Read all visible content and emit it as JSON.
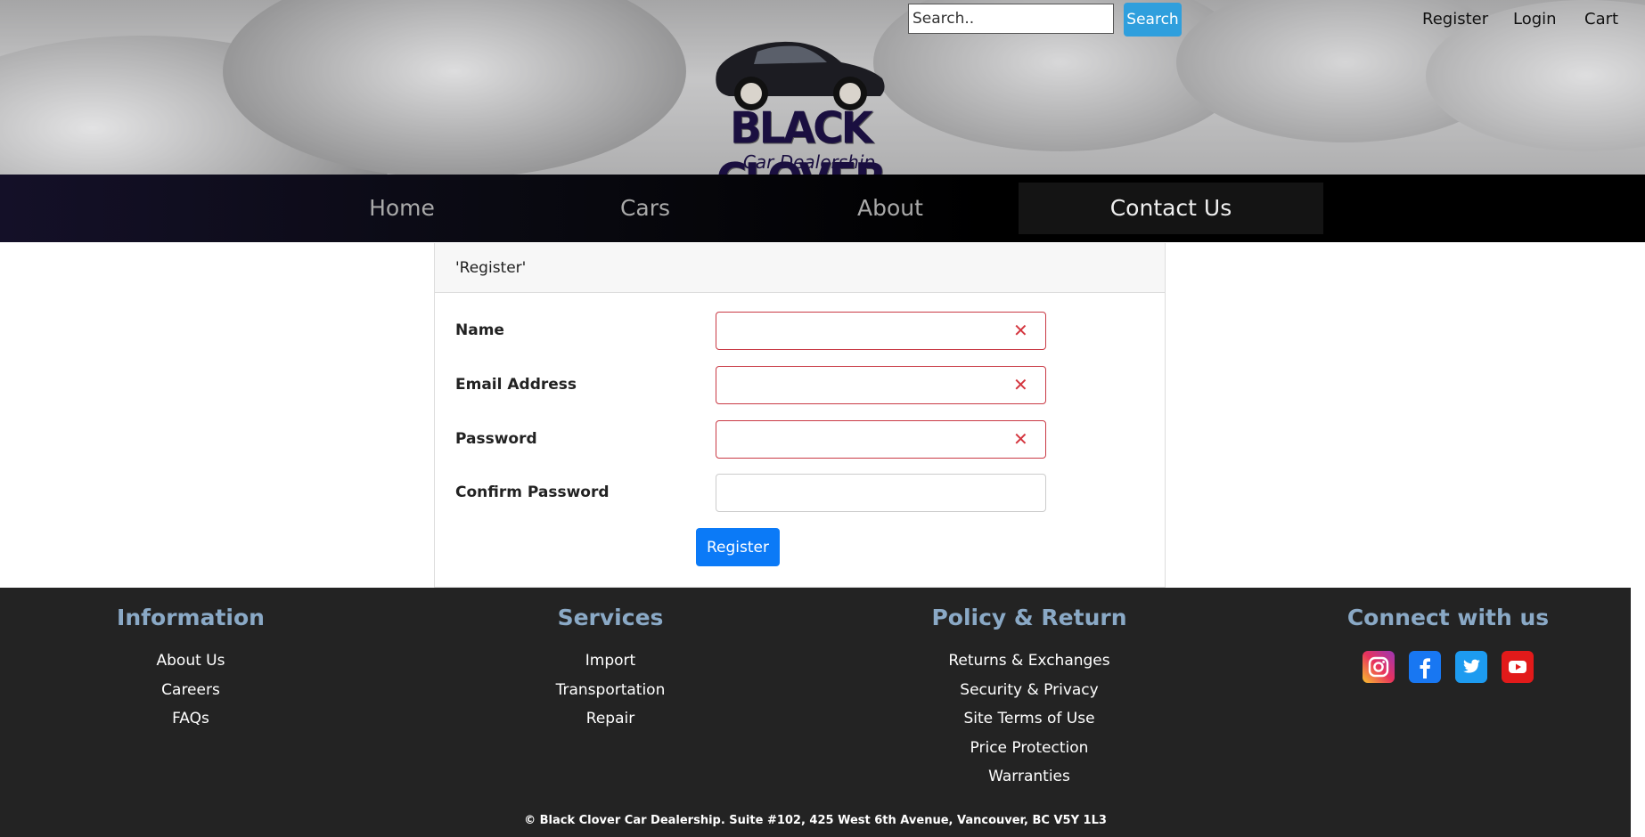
{
  "header": {
    "search_placeholder": "Search..",
    "search_button": "Search",
    "links": [
      "Register",
      "Login",
      "Cart"
    ],
    "logo_title": "BLACK CLOVER",
    "logo_subtitle": "Car Dealership"
  },
  "nav": {
    "items": [
      "Home",
      "Cars",
      "About",
      "Contact Us"
    ],
    "active": "Contact Us"
  },
  "form": {
    "title": "'Register'",
    "fields": [
      {
        "label": "Name",
        "value": "",
        "invalid": true
      },
      {
        "label": "Email Address",
        "value": "",
        "invalid": true
      },
      {
        "label": "Password",
        "value": "",
        "invalid": true
      },
      {
        "label": "Confirm Password",
        "value": "",
        "invalid": false
      }
    ],
    "submit_label": "Register"
  },
  "footer": {
    "columns": [
      {
        "heading": "Information",
        "links": [
          "About Us",
          "Careers",
          "FAQs"
        ]
      },
      {
        "heading": "Services",
        "links": [
          "Import",
          "Transportation",
          "Repair"
        ]
      },
      {
        "heading": "Policy & Return",
        "links": [
          "Returns & Exchanges",
          "Security & Privacy",
          "Site Terms of Use",
          "Price Protection",
          "Warranties"
        ]
      },
      {
        "heading": "Connect with us",
        "social": [
          "instagram-icon",
          "facebook-icon",
          "twitter-icon",
          "youtube-icon"
        ]
      }
    ],
    "copyright": "© Black Clover Car Dealership. Suite #102, 425 West 6th Avenue, Vancouver, BC V5Y 1L3"
  },
  "colors": {
    "search_button": "#2f9fdd",
    "register_button": "#0b7af7",
    "invalid_border": "#c93a45",
    "footer_bg": "#232323",
    "footer_heading": "#8aa9c6",
    "logo": "#1a0f40"
  }
}
